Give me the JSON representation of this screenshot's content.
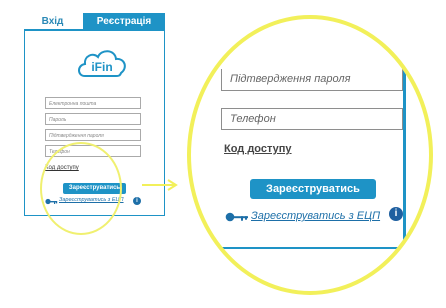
{
  "tabs": {
    "login": "Вхід",
    "register": "Реєстрація"
  },
  "logo": {
    "text": "iFin",
    "color": "#1e93c6"
  },
  "form": {
    "email_placeholder": "Електронна пошта",
    "password_placeholder": "Пароль",
    "confirm_placeholder": "Підтвердження пароля",
    "phone_placeholder": "Телефон",
    "access_code_label": "Код доступу",
    "register_button": "Зареєструватись",
    "ecp_link": "Зареєструватись з ЕЦП",
    "info_glyph": "i"
  },
  "colors": {
    "accent": "#1e93c6",
    "highlight": "#f2f05a",
    "link": "#1d6fa8"
  },
  "icons": [
    "cloud-logo-icon",
    "key-icon",
    "info-icon",
    "arrow-right-icon"
  ]
}
